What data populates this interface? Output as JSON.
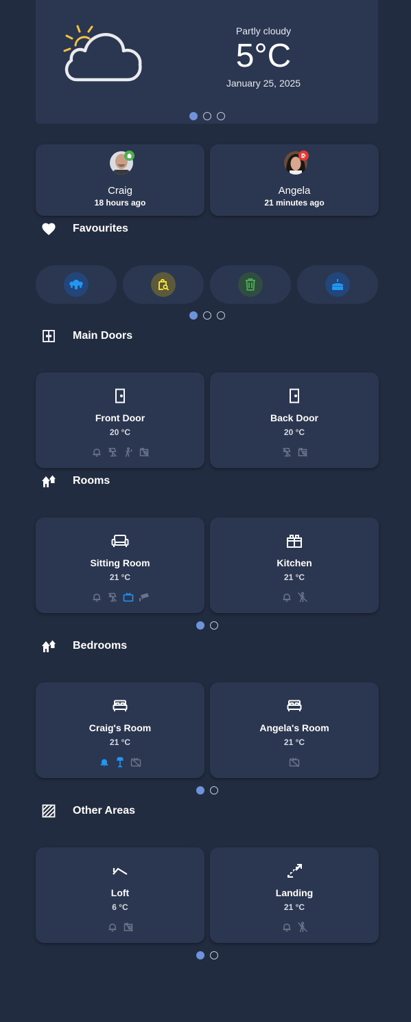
{
  "weather": {
    "condition": "Partly cloudy",
    "temperature": "5°C",
    "date": "January 25, 2025",
    "icon": "partly-cloudy-icon"
  },
  "weather_pager": {
    "pages": 3,
    "active": 1
  },
  "people": [
    {
      "name": "Craig",
      "last_changed": "18 hours ago",
      "state": "home",
      "badge_icon": "home-icon",
      "badge_color": "#4caf50"
    },
    {
      "name": "Angela",
      "last_changed": "21 minutes ago",
      "state": "away",
      "badge_icon": "leave-icon",
      "badge_color": "#e53935"
    }
  ],
  "sections": {
    "favourites": {
      "title": "Favourites",
      "icon": "heart-icon"
    },
    "main_doors": {
      "title": "Main Doors",
      "icon": "double-door-icon"
    },
    "rooms": {
      "title": "Rooms",
      "icon": "home-group-icon"
    },
    "bedrooms": {
      "title": "Bedrooms",
      "icon": "home-group-icon"
    },
    "other_areas": {
      "title": "Other Areas",
      "icon": "hatched-square-icon"
    }
  },
  "favourites": [
    {
      "icon": "lightbulb-group-icon",
      "color": "#2196f3"
    },
    {
      "icon": "shopping-search-icon",
      "color": "#ffeb3b"
    },
    {
      "icon": "trash-can-icon",
      "color": "#4caf50"
    },
    {
      "icon": "cake-icon",
      "color": "#2196f3"
    }
  ],
  "favourites_pager": {
    "pages": 3,
    "active": 1
  },
  "main_doors": [
    {
      "name": "Front Door",
      "temperature": "20 °C",
      "icon": "door-icon",
      "statuses": [
        "bell-icon",
        "lamp-off-icon",
        "motion-sensor-icon",
        "camera-off-icon"
      ]
    },
    {
      "name": "Back Door",
      "temperature": "20 °C",
      "icon": "door-icon",
      "statuses": [
        "lamp-off-icon",
        "camera-off-icon"
      ]
    }
  ],
  "rooms": [
    {
      "name": "Sitting Room",
      "temperature": "21 °C",
      "icon": "sofa-icon",
      "statuses": [
        "bell-icon",
        "lamp-off-icon",
        "tv-icon",
        "cctv-icon"
      ],
      "active_statuses": [
        "tv-icon"
      ]
    },
    {
      "name": "Kitchen",
      "temperature": "21 °C",
      "icon": "fridge-icon",
      "statuses": [
        "bell-icon",
        "motion-sensor-off-icon"
      ],
      "active_statuses": []
    }
  ],
  "rooms_pager": {
    "pages": 2,
    "active": 1
  },
  "bedrooms": [
    {
      "name": "Craig's Room",
      "temperature": "21 °C",
      "icon": "bed-icon",
      "statuses": [
        "bell-icon",
        "floor-lamp-icon",
        "tv-off-icon"
      ],
      "active_statuses": [
        "bell-icon",
        "floor-lamp-icon"
      ]
    },
    {
      "name": "Angela's Room",
      "temperature": "21 °C",
      "icon": "bed-icon",
      "statuses": [
        "tv-off-icon"
      ],
      "active_statuses": []
    }
  ],
  "bedrooms_pager": {
    "pages": 2,
    "active": 1
  },
  "other_areas": [
    {
      "name": "Loft",
      "temperature": "6 °C",
      "icon": "roof-icon",
      "statuses": [
        "bell-icon",
        "camera-off-icon"
      ],
      "active_statuses": []
    },
    {
      "name": "Landing",
      "temperature": "21 °C",
      "icon": "stairs-icon",
      "statuses": [
        "bell-icon",
        "motion-sensor-off-icon"
      ],
      "active_statuses": []
    }
  ],
  "other_areas_pager": {
    "pages": 2,
    "active": 1
  },
  "colors": {
    "background": "#222c40",
    "card": "#2b3650",
    "active_blue": "#2196f3",
    "inactive_icon": "#6b7489",
    "pager_active": "#6e93d8"
  }
}
